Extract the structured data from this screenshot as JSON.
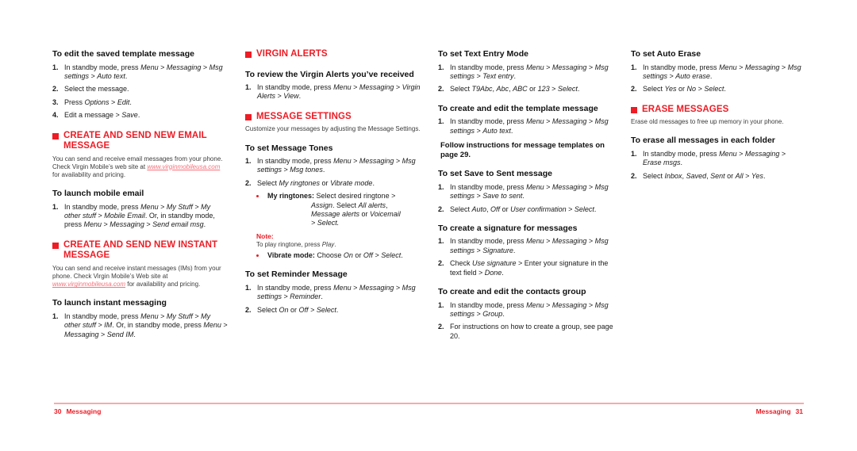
{
  "accent_color": "#EE1C25",
  "link_color": "#F4717A",
  "rule_color": "#FAA8AC",
  "footer": {
    "left_page": "30",
    "left_label": "Messaging",
    "right_label": "Messaging",
    "right_page": "31"
  },
  "column1": {
    "heading1": "To edit the saved template message",
    "steps1": [
      {
        "num": "1.",
        "parts": [
          {
            "t": "In standby mode, press ",
            "i": false
          },
          {
            "t": "Menu",
            "i": true
          },
          {
            "t": " > ",
            "i": false
          },
          {
            "t": "Messaging",
            "i": true
          },
          {
            "t": " > ",
            "i": false
          },
          {
            "t": "Msg settings",
            "i": true
          },
          {
            "t": " > ",
            "i": false
          },
          {
            "t": "Auto text",
            "i": true
          },
          {
            "t": ".",
            "i": false
          }
        ]
      },
      {
        "num": "2.",
        "parts": [
          {
            "t": "Select the message.",
            "i": false
          }
        ]
      },
      {
        "num": "3.",
        "parts": [
          {
            "t": "Press ",
            "i": false
          },
          {
            "t": "Options",
            "i": true
          },
          {
            "t": " > ",
            "i": false
          },
          {
            "t": "Edit",
            "i": true
          },
          {
            "t": ".",
            "i": false
          }
        ]
      },
      {
        "num": "4.",
        "parts": [
          {
            "t": "Edit a message > ",
            "i": false
          },
          {
            "t": "Save",
            "i": true
          },
          {
            "t": ".",
            "i": false
          }
        ]
      }
    ],
    "section1": "CREATE AND SEND NEW EMAIL MESSAGE",
    "intro1_before": "You can send and receive email messages from your phone. Check Virgin Mobile’s web site at ",
    "intro1_url": "www.virginmobileusa.com",
    "intro1_after": " for availability and pricing.",
    "heading2": "To launch mobile email",
    "steps2": [
      {
        "num": "1.",
        "parts": [
          {
            "t": "In standby mode, press ",
            "i": false
          },
          {
            "t": "Menu",
            "i": true
          },
          {
            "t": " > ",
            "i": false
          },
          {
            "t": "My Stuff",
            "i": true
          },
          {
            "t": " > ",
            "i": false
          },
          {
            "t": "My other stuff",
            "i": true
          },
          {
            "t": " > ",
            "i": false
          },
          {
            "t": "Mobile Email",
            "i": true
          },
          {
            "t": ". Or, in standby mode, press ",
            "i": false
          },
          {
            "t": "Menu",
            "i": true
          },
          {
            "t": " > ",
            "i": false
          },
          {
            "t": "Messaging",
            "i": true
          },
          {
            "t": " > ",
            "i": false
          },
          {
            "t": "Send email msg",
            "i": true
          },
          {
            "t": ".",
            "i": false
          }
        ]
      }
    ],
    "section2": "CREATE AND SEND NEW INSTANT MESSAGE",
    "intro2_before": "You can send and receive instant messages (IMs) from your phone. Check Virgin Mobile’s Web site at ",
    "intro2_url": "www.virginmobileusa.com",
    "intro2_after": " for availability and pricing.",
    "heading3": "To launch instant messaging",
    "steps3": [
      {
        "num": "1.",
        "parts": [
          {
            "t": "In standby mode, press ",
            "i": false
          },
          {
            "t": "Menu",
            "i": true
          },
          {
            "t": " > ",
            "i": false
          },
          {
            "t": "My Stuff",
            "i": true
          },
          {
            "t": " > ",
            "i": false
          },
          {
            "t": "My other stuff",
            "i": true
          },
          {
            "t": " > ",
            "i": false
          },
          {
            "t": "IM",
            "i": true
          },
          {
            "t": ". Or, in standby mode, press ",
            "i": false
          },
          {
            "t": "Menu",
            "i": true
          },
          {
            "t": " > ",
            "i": false
          },
          {
            "t": "Messaging",
            "i": true
          },
          {
            "t": " > ",
            "i": false
          },
          {
            "t": "Send IM",
            "i": true
          },
          {
            "t": ".",
            "i": false
          }
        ]
      }
    ]
  },
  "column2": {
    "section1": "VIRGIN ALERTS",
    "heading1": "To review the Virgin Alerts you’ve received",
    "steps1": [
      {
        "num": "1.",
        "parts": [
          {
            "t": "In standby mode, press ",
            "i": false
          },
          {
            "t": "Menu",
            "i": true
          },
          {
            "t": " > ",
            "i": false
          },
          {
            "t": "Messaging",
            "i": true
          },
          {
            "t": " > ",
            "i": false
          },
          {
            "t": "Virgin Alerts",
            "i": true
          },
          {
            "t": " > ",
            "i": false
          },
          {
            "t": "View",
            "i": true
          },
          {
            "t": ".",
            "i": false
          }
        ]
      }
    ],
    "section2": "MESSAGE SETTINGS",
    "intro2": "Customize your messages by adjusting the Message Settings.",
    "heading2": "To set Message Tones",
    "steps2": [
      {
        "num": "1.",
        "parts": [
          {
            "t": "In standby mode, press ",
            "i": false
          },
          {
            "t": "Menu",
            "i": true
          },
          {
            "t": " > ",
            "i": false
          },
          {
            "t": "Messaging",
            "i": true
          },
          {
            "t": " > ",
            "i": false
          },
          {
            "t": "Msg settings",
            "i": true
          },
          {
            "t": " > ",
            "i": false
          },
          {
            "t": "Msg tones",
            "i": true
          },
          {
            "t": ".",
            "i": false
          }
        ]
      },
      {
        "num": "2.",
        "parts": [
          {
            "t": "Select ",
            "i": false
          },
          {
            "t": "My ringtones",
            "i": true
          },
          {
            "t": " or ",
            "i": false
          },
          {
            "t": "Vibrate mode",
            "i": true
          },
          {
            "t": ".",
            "i": false
          }
        ]
      }
    ],
    "bullet1_label": "My ringtones:",
    "bullet1_line1": " Select desired ringtone >",
    "bullet1_rest": [
      [
        {
          "t": "Assign",
          "i": true
        },
        {
          "t": ". Select ",
          "i": false
        },
        {
          "t": "All alerts",
          "i": true
        },
        {
          "t": ",",
          "i": false
        }
      ],
      [
        {
          "t": "Message alerts",
          "i": true
        },
        {
          "t": " or ",
          "i": false
        },
        {
          "t": "Voicemail",
          "i": true
        }
      ],
      [
        {
          "t": "> Select.",
          "i": true
        }
      ]
    ],
    "note_label": "Note:",
    "note_text_before": "To play ringtone, press ",
    "note_text_italic": "Play",
    "note_text_after": ".",
    "bullet2_label": "Vibrate mode:",
    "bullet2_parts": [
      {
        "t": " Choose ",
        "i": false
      },
      {
        "t": "On",
        "i": true
      },
      {
        "t": " or ",
        "i": false
      },
      {
        "t": "Off",
        "i": true
      },
      {
        "t": " > ",
        "i": false
      },
      {
        "t": "Select",
        "i": true
      },
      {
        "t": ".",
        "i": false
      }
    ],
    "heading3": "To set Reminder Message",
    "steps3": [
      {
        "num": "1.",
        "parts": [
          {
            "t": "In standby mode, press ",
            "i": false
          },
          {
            "t": "Menu",
            "i": true
          },
          {
            "t": " > ",
            "i": false
          },
          {
            "t": "Messaging",
            "i": true
          },
          {
            "t": " > ",
            "i": false
          },
          {
            "t": "Msg settings",
            "i": true
          },
          {
            "t": " > ",
            "i": false
          },
          {
            "t": "Reminder",
            "i": true
          },
          {
            "t": ".",
            "i": false
          }
        ]
      },
      {
        "num": "2.",
        "parts": [
          {
            "t": "Select ",
            "i": false
          },
          {
            "t": "On",
            "i": true
          },
          {
            "t": " or ",
            "i": false
          },
          {
            "t": "Off",
            "i": true
          },
          {
            "t": " > ",
            "i": false
          },
          {
            "t": "Select",
            "i": true
          },
          {
            "t": ".",
            "i": false
          }
        ]
      }
    ]
  },
  "column3": {
    "heading1": "To set Text Entry Mode",
    "steps1": [
      {
        "num": "1.",
        "parts": [
          {
            "t": "In standby mode, press ",
            "i": false
          },
          {
            "t": "Menu",
            "i": true
          },
          {
            "t": " > ",
            "i": false
          },
          {
            "t": "Messaging",
            "i": true
          },
          {
            "t": " > ",
            "i": false
          },
          {
            "t": "Msg settings",
            "i": true
          },
          {
            "t": " > ",
            "i": false
          },
          {
            "t": "Text entry",
            "i": true
          },
          {
            "t": ".",
            "i": false
          }
        ]
      },
      {
        "num": "2.",
        "parts": [
          {
            "t": "Select ",
            "i": false
          },
          {
            "t": "T9Abc",
            "i": true
          },
          {
            "t": ", ",
            "i": false
          },
          {
            "t": "Abc",
            "i": true
          },
          {
            "t": ", ",
            "i": false
          },
          {
            "t": "ABC",
            "i": true
          },
          {
            "t": " or ",
            "i": false
          },
          {
            "t": "123",
            "i": true
          },
          {
            "t": " > ",
            "i": false
          },
          {
            "t": "Select",
            "i": true
          },
          {
            "t": ".",
            "i": false
          }
        ]
      }
    ],
    "heading2": "To create and edit the template message",
    "steps2": [
      {
        "num": "1.",
        "parts": [
          {
            "t": "In standby mode, press ",
            "i": false
          },
          {
            "t": "Menu",
            "i": true
          },
          {
            "t": " > ",
            "i": false
          },
          {
            "t": "Messaging",
            "i": true
          },
          {
            "t": " > ",
            "i": false
          },
          {
            "t": "Msg settings",
            "i": true
          },
          {
            "t": " > ",
            "i": false
          },
          {
            "t": "Auto text",
            "i": true
          },
          {
            "t": ".",
            "i": false
          }
        ]
      }
    ],
    "callout": "Follow instructions for message templates on page 29.",
    "heading3": "To set Save to Sent message",
    "steps3": [
      {
        "num": "1.",
        "parts": [
          {
            "t": "In standby mode, press ",
            "i": false
          },
          {
            "t": "Menu",
            "i": true
          },
          {
            "t": " > ",
            "i": false
          },
          {
            "t": "Messaging",
            "i": true
          },
          {
            "t": " > ",
            "i": false
          },
          {
            "t": "Msg settings",
            "i": true
          },
          {
            "t": " > ",
            "i": false
          },
          {
            "t": "Save to sent",
            "i": true
          },
          {
            "t": ".",
            "i": false
          }
        ]
      },
      {
        "num": "2.",
        "parts": [
          {
            "t": "Select ",
            "i": false
          },
          {
            "t": "Auto",
            "i": true
          },
          {
            "t": ", ",
            "i": false
          },
          {
            "t": "Off",
            "i": true
          },
          {
            "t": " or ",
            "i": false
          },
          {
            "t": "User confirmation",
            "i": true
          },
          {
            "t": " > ",
            "i": false
          },
          {
            "t": "Select",
            "i": true
          },
          {
            "t": ".",
            "i": false
          }
        ]
      }
    ],
    "heading4": "To create a signature for messages",
    "steps4": [
      {
        "num": "1.",
        "parts": [
          {
            "t": "In standby mode, press ",
            "i": false
          },
          {
            "t": "Menu",
            "i": true
          },
          {
            "t": " > ",
            "i": false
          },
          {
            "t": "Messaging",
            "i": true
          },
          {
            "t": " > ",
            "i": false
          },
          {
            "t": "Msg settings",
            "i": true
          },
          {
            "t": " > ",
            "i": false
          },
          {
            "t": "Signature",
            "i": true
          },
          {
            "t": ".",
            "i": false
          }
        ]
      },
      {
        "num": "2.",
        "parts": [
          {
            "t": "Check ",
            "i": false
          },
          {
            "t": "Use signature",
            "i": true
          },
          {
            "t": " > Enter your signature in the text field > ",
            "i": false
          },
          {
            "t": "Done",
            "i": true
          },
          {
            "t": ".",
            "i": false
          }
        ]
      }
    ],
    "heading5": "To create and edit the contacts group",
    "steps5": [
      {
        "num": "1.",
        "parts": [
          {
            "t": "In standby mode, press ",
            "i": false
          },
          {
            "t": "Menu",
            "i": true
          },
          {
            "t": " > ",
            "i": false
          },
          {
            "t": "Messaging",
            "i": true
          },
          {
            "t": " > ",
            "i": false
          },
          {
            "t": "Msg settings",
            "i": true
          },
          {
            "t": " > ",
            "i": false
          },
          {
            "t": "Group",
            "i": true
          },
          {
            "t": ".",
            "i": false
          }
        ]
      },
      {
        "num": "2.",
        "parts": [
          {
            "t": "For instructions on how to create a group, see page 20.",
            "i": false
          }
        ]
      }
    ]
  },
  "column4": {
    "heading1": "To set Auto Erase",
    "steps1": [
      {
        "num": "1.",
        "parts": [
          {
            "t": "In standby mode, press ",
            "i": false
          },
          {
            "t": "Menu",
            "i": true
          },
          {
            "t": " > ",
            "i": false
          },
          {
            "t": "Messaging",
            "i": true
          },
          {
            "t": " > ",
            "i": false
          },
          {
            "t": "Msg settings",
            "i": true
          },
          {
            "t": " > ",
            "i": false
          },
          {
            "t": "Auto erase",
            "i": true
          },
          {
            "t": ".",
            "i": false
          }
        ]
      },
      {
        "num": "2.",
        "parts": [
          {
            "t": "Select ",
            "i": false
          },
          {
            "t": "Yes",
            "i": true
          },
          {
            "t": " or ",
            "i": false
          },
          {
            "t": "No",
            "i": true
          },
          {
            "t": " > ",
            "i": false
          },
          {
            "t": "Select",
            "i": true
          },
          {
            "t": ".",
            "i": false
          }
        ]
      }
    ],
    "section1": "ERASE MESSAGES",
    "intro1": "Erase old messages to free up memory in your phone.",
    "heading2": "To erase all messages in each folder",
    "steps2": [
      {
        "num": "1.",
        "parts": [
          {
            "t": "In standby mode, press ",
            "i": false
          },
          {
            "t": "Menu",
            "i": true
          },
          {
            "t": " > ",
            "i": false
          },
          {
            "t": "Messaging",
            "i": true
          },
          {
            "t": " > ",
            "i": false
          },
          {
            "t": "Erase msgs",
            "i": true
          },
          {
            "t": ".",
            "i": false
          }
        ]
      },
      {
        "num": "2.",
        "parts": [
          {
            "t": "Select ",
            "i": false
          },
          {
            "t": "Inbox",
            "i": true
          },
          {
            "t": ", ",
            "i": false
          },
          {
            "t": "Saved",
            "i": true
          },
          {
            "t": ", ",
            "i": false
          },
          {
            "t": "Sent",
            "i": true
          },
          {
            "t": " or ",
            "i": false
          },
          {
            "t": "All",
            "i": true
          },
          {
            "t": " > ",
            "i": false
          },
          {
            "t": "Yes",
            "i": true
          },
          {
            "t": ".",
            "i": false
          }
        ]
      }
    ]
  }
}
